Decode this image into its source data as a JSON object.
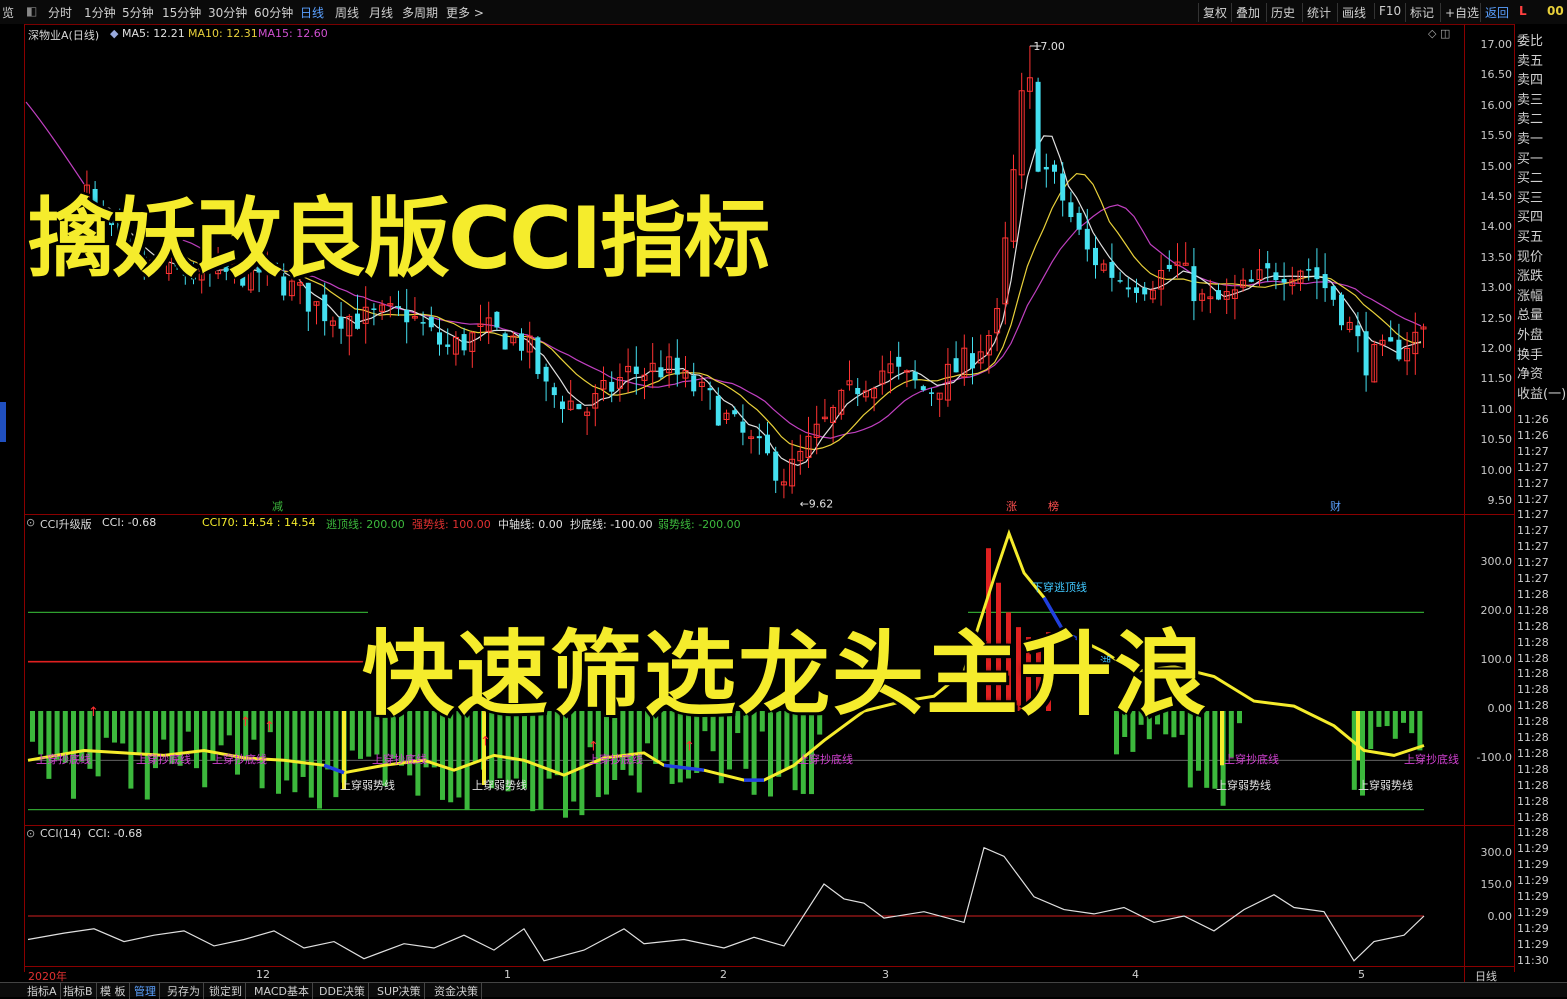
{
  "toolbar": {
    "first": "览",
    "tabs": [
      "分时",
      "1分钟",
      "5分钟",
      "15分钟",
      "30分钟",
      "60分钟",
      "日线",
      "周线",
      "月线",
      "多周期",
      "更多 >"
    ],
    "active_tab": "日线",
    "right_tabs": [
      "复权",
      "叠加",
      "历史",
      "统计",
      "画线",
      "F10",
      "标记",
      "+自选",
      "返回"
    ],
    "right_active": "返回",
    "corner_l": "L",
    "corner_num": "00"
  },
  "main_pane": {
    "stock_label": "深物业A(日线)",
    "ma5": "MA5: 12.21",
    "ma10": "MA10: 12.31",
    "ma15": "MA15: 12.60",
    "high_label": "17.00",
    "low_label": "9.62",
    "markers": [
      "减",
      "涨",
      "榜",
      "财"
    ],
    "y_ticks": [
      "17.00",
      "16.50",
      "16.00",
      "15.50",
      "15.00",
      "14.50",
      "14.00",
      "13.50",
      "13.00",
      "12.50",
      "12.00",
      "11.50",
      "11.00",
      "10.50",
      "10.00",
      "9.50"
    ]
  },
  "cci_upgrade_pane": {
    "title": "CCI升级版",
    "cci": "CCI: -0.68",
    "cci70": "CCI70: 14.54 : 14.54",
    "line_top": "逃顶线: 200.00",
    "line_strong": "强势线: 100.00",
    "line_mid": "中轴线: 0.00",
    "line_bottom": "抄底线: -100.00",
    "line_weak": "弱势线: -200.00",
    "y_ticks": [
      "300.0",
      "200.0",
      "100.0",
      "0.00",
      "-100.0"
    ],
    "annotations": {
      "up_weak": "上穿弱势线",
      "up_bottom": "上穿抄底线",
      "down_top": "下穿逃顶线",
      "small": "湖"
    }
  },
  "cci14_pane": {
    "title": "CCI(14)",
    "cci": "CCI: -0.68",
    "y_ticks": [
      "300.0",
      "150.0",
      "0.00"
    ]
  },
  "date_axis": {
    "labels": [
      "2020年",
      "12",
      "1",
      "2",
      "3",
      "4",
      "5"
    ],
    "period": "日线"
  },
  "info_column": {
    "items": [
      "委比",
      "卖五",
      "卖四",
      "卖三",
      "卖二",
      "卖一",
      "买一",
      "买二",
      "买三",
      "买四",
      "买五",
      "现价",
      "涨跌",
      "涨幅",
      "总量",
      "外盘",
      "换手",
      "净资",
      "收益(一)"
    ],
    "times": [
      "11:26",
      "11:26",
      "11:27",
      "11:27",
      "11:27",
      "11:27",
      "11:27",
      "11:27",
      "11:27",
      "11:27",
      "11:27",
      "11:28",
      "11:28",
      "11:28",
      "11:28",
      "11:28",
      "11:28",
      "11:28",
      "11:28",
      "11:28",
      "11:28",
      "11:28",
      "11:28",
      "11:28",
      "11:28",
      "11:28",
      "11:28",
      "11:29",
      "11:29",
      "11:29",
      "11:29",
      "11:29",
      "11:29",
      "11:29",
      "11:30"
    ]
  },
  "bottom_tabs": [
    "指标A",
    "指标B",
    "模 板",
    "管理",
    "另存为",
    "锁定到",
    "MACD基本",
    "DDE决策",
    "SUP决策",
    "资金决策"
  ],
  "bottom_active": "管理",
  "overlay": {
    "title1": "擒妖改良版CCI指标",
    "title2": "快速筛选龙头主升浪"
  },
  "colors": {
    "up": "#ff3333",
    "down": "#44e0f0",
    "ma5": "#e0e0e0",
    "ma10": "#e8d03a",
    "ma15": "#c040c0",
    "green_bar": "#3cb83c",
    "yellow": "#f5ec2c",
    "overlay_text": "#f5ec2c"
  }
}
